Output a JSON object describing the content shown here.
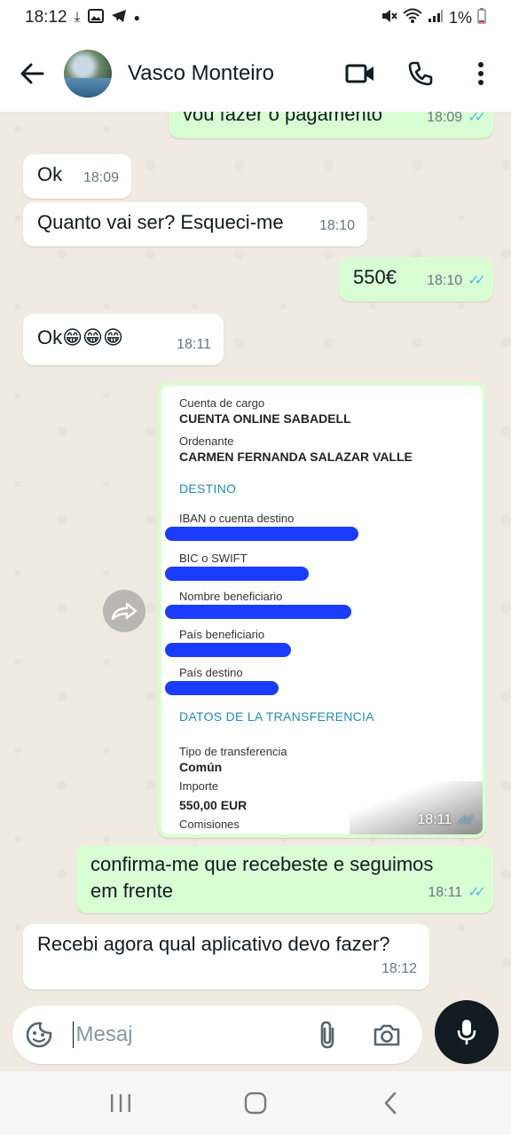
{
  "status_bar": {
    "time": "18:12",
    "battery": "1%"
  },
  "header": {
    "contact_name": "Vasco Monteiro"
  },
  "messages": [
    {
      "text": "vou fazer o pagamento",
      "time": "18:09"
    },
    {
      "text": "Ok",
      "time": "18:09"
    },
    {
      "text": "Quanto vai ser? Esqueci-me",
      "time": "18:10"
    },
    {
      "text": "550€",
      "time": "18:10"
    },
    {
      "text": "Ok😁😁😁",
      "time": "18:11"
    },
    {
      "text": "confirma-me que recebeste e seguimos em frente",
      "time": "18:11"
    },
    {
      "text": "Recebi agora qual aplicativo devo fazer?",
      "time": "18:12"
    }
  ],
  "image_message": {
    "time": "18:11",
    "doc": {
      "cuenta_label": "Cuenta de cargo",
      "cuenta_value": "CUENTA ONLINE SABADELL",
      "ordenante_label": "Ordenante",
      "ordenante_value": "CARMEN FERNANDA SALAZAR VALLE",
      "destino_title": "DESTINO",
      "iban_label": "IBAN o cuenta destino",
      "bic_label": "BIC o SWIFT",
      "beneficiario_label": "Nombre beneficiario",
      "pais_beneficiario_label": "País beneficiario",
      "pais_destino_label": "País destino",
      "datos_title": "DATOS DE LA TRANSFERENCIA",
      "tipo_label": "Tipo de transferencia",
      "tipo_value": "Común",
      "importe_label": "Importe",
      "importe_value": "550,00 EUR",
      "comisiones_label": "Comisiones"
    }
  },
  "input": {
    "placeholder": "Mesaj"
  },
  "colors": {
    "outgoing_bubble": "#d9fdd3",
    "incoming_bubble": "#ffffff",
    "read_ticks": "#53bdeb",
    "chat_bg": "#efeae2"
  },
  "icons": [
    "download-icon",
    "gallery-icon",
    "telegram-icon",
    "mute-icon",
    "wifi-icon",
    "signal-icon",
    "battery-icon",
    "back-arrow-icon",
    "video-call-icon",
    "phone-icon",
    "more-options-icon",
    "forward-icon",
    "sticker-icon",
    "attach-icon",
    "camera-icon",
    "mic-icon",
    "recent-apps-icon",
    "home-icon",
    "nav-back-icon"
  ]
}
